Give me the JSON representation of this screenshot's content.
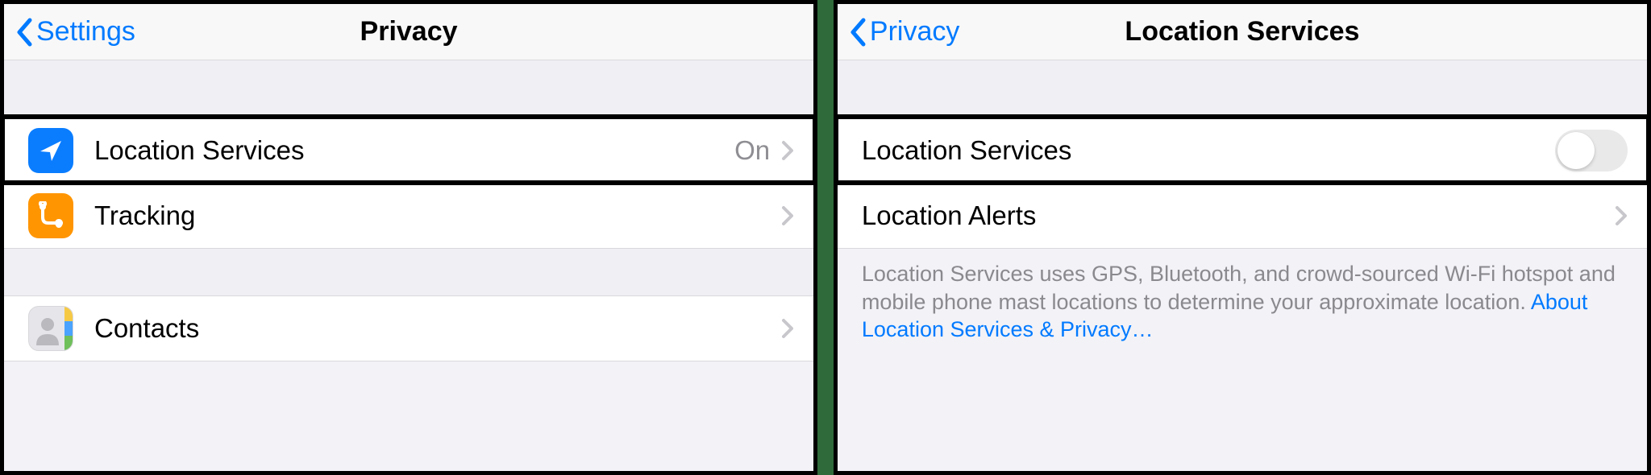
{
  "left": {
    "back_label": "Settings",
    "title": "Privacy",
    "rows": [
      {
        "label": "Location Services",
        "value": "On"
      },
      {
        "label": "Tracking"
      },
      {
        "label": "Contacts"
      }
    ]
  },
  "right": {
    "back_label": "Privacy",
    "title": "Location Services",
    "rows": [
      {
        "label": "Location Services",
        "toggle_on": false
      },
      {
        "label": "Location Alerts"
      }
    ],
    "footer_text": "Location Services uses GPS, Bluetooth, and crowd-sourced Wi-Fi hotspot and mobile phone mast locations to determine your approximate location. ",
    "footer_link": "About Location Services & Privacy…"
  }
}
